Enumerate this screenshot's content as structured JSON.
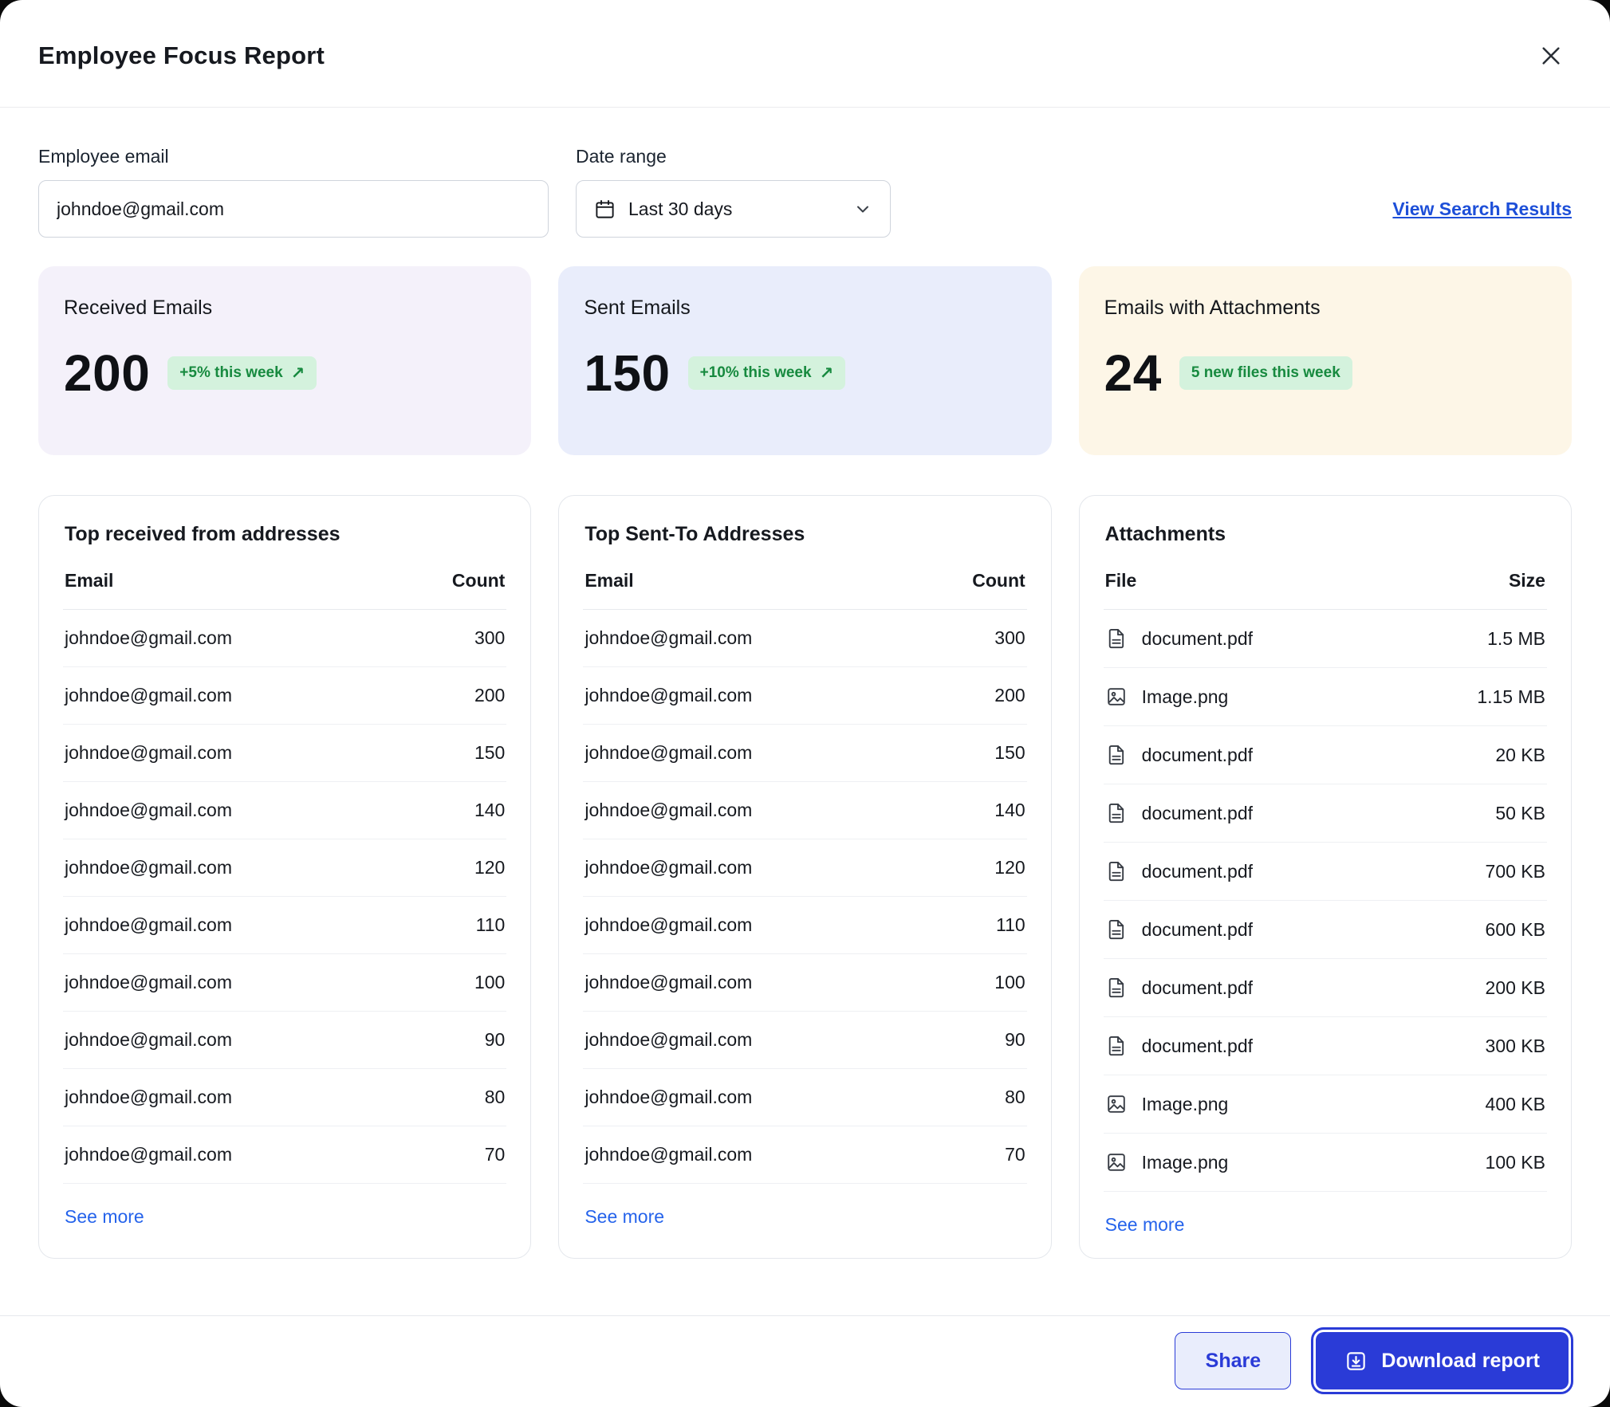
{
  "colors": {
    "accent": "#2a3bd7",
    "link": "#1d4fd8",
    "see_more": "#2563eb",
    "badge_bg": "#d4f2dd",
    "badge_text": "#178a3f"
  },
  "header": {
    "title": "Employee Focus Report"
  },
  "form": {
    "email": {
      "label": "Employee email",
      "value": "johndoe@gmail.com"
    },
    "date": {
      "label": "Date range",
      "value": "Last 30 days"
    },
    "view_results": "View Search Results"
  },
  "stats": [
    {
      "label": "Received Emails",
      "value": "200",
      "badge": "+5% this week",
      "arrow": "↗",
      "bg": "#f4f1fa"
    },
    {
      "label": "Sent Emails",
      "value": "150",
      "badge": "+10% this week",
      "arrow": "↗",
      "bg": "#e9edfb"
    },
    {
      "label": "Emails with Attachments",
      "value": "24",
      "badge": "5 new files this week",
      "arrow": "",
      "bg": "#fdf6e7"
    }
  ],
  "received": {
    "title": "Top received from addresses",
    "columns": {
      "c1": "Email",
      "c2": "Count"
    },
    "rows": [
      {
        "email": "johndoe@gmail.com",
        "count": "300"
      },
      {
        "email": "johndoe@gmail.com",
        "count": "200"
      },
      {
        "email": "johndoe@gmail.com",
        "count": "150"
      },
      {
        "email": "johndoe@gmail.com",
        "count": "140"
      },
      {
        "email": "johndoe@gmail.com",
        "count": "120"
      },
      {
        "email": "johndoe@gmail.com",
        "count": "110"
      },
      {
        "email": "johndoe@gmail.com",
        "count": "100"
      },
      {
        "email": "johndoe@gmail.com",
        "count": "90"
      },
      {
        "email": "johndoe@gmail.com",
        "count": "80"
      },
      {
        "email": "johndoe@gmail.com",
        "count": "70"
      }
    ],
    "see_more": "See more"
  },
  "sent": {
    "title": "Top Sent-To Addresses",
    "columns": {
      "c1": "Email",
      "c2": "Count"
    },
    "rows": [
      {
        "email": "johndoe@gmail.com",
        "count": "300"
      },
      {
        "email": "johndoe@gmail.com",
        "count": "200"
      },
      {
        "email": "johndoe@gmail.com",
        "count": "150"
      },
      {
        "email": "johndoe@gmail.com",
        "count": "140"
      },
      {
        "email": "johndoe@gmail.com",
        "count": "120"
      },
      {
        "email": "johndoe@gmail.com",
        "count": "110"
      },
      {
        "email": "johndoe@gmail.com",
        "count": "100"
      },
      {
        "email": "johndoe@gmail.com",
        "count": "90"
      },
      {
        "email": "johndoe@gmail.com",
        "count": "80"
      },
      {
        "email": "johndoe@gmail.com",
        "count": "70"
      }
    ],
    "see_more": "See more"
  },
  "attachments": {
    "title": "Attachments",
    "columns": {
      "c1": "File",
      "c2": "Size"
    },
    "rows": [
      {
        "name": "document.pdf",
        "type": "pdf",
        "size": "1.5 MB"
      },
      {
        "name": "Image.png",
        "type": "image",
        "size": "1.15 MB"
      },
      {
        "name": "document.pdf",
        "type": "pdf",
        "size": "20 KB"
      },
      {
        "name": "document.pdf",
        "type": "pdf",
        "size": "50 KB"
      },
      {
        "name": "document.pdf",
        "type": "pdf",
        "size": "700 KB"
      },
      {
        "name": "document.pdf",
        "type": "pdf",
        "size": "600 KB"
      },
      {
        "name": "document.pdf",
        "type": "pdf",
        "size": "200 KB"
      },
      {
        "name": "document.pdf",
        "type": "pdf",
        "size": "300 KB"
      },
      {
        "name": "Image.png",
        "type": "image",
        "size": "400 KB"
      },
      {
        "name": "Image.png",
        "type": "image",
        "size": "100 KB"
      }
    ],
    "see_more": "See more"
  },
  "footer": {
    "share": "Share",
    "download": "Download report"
  }
}
